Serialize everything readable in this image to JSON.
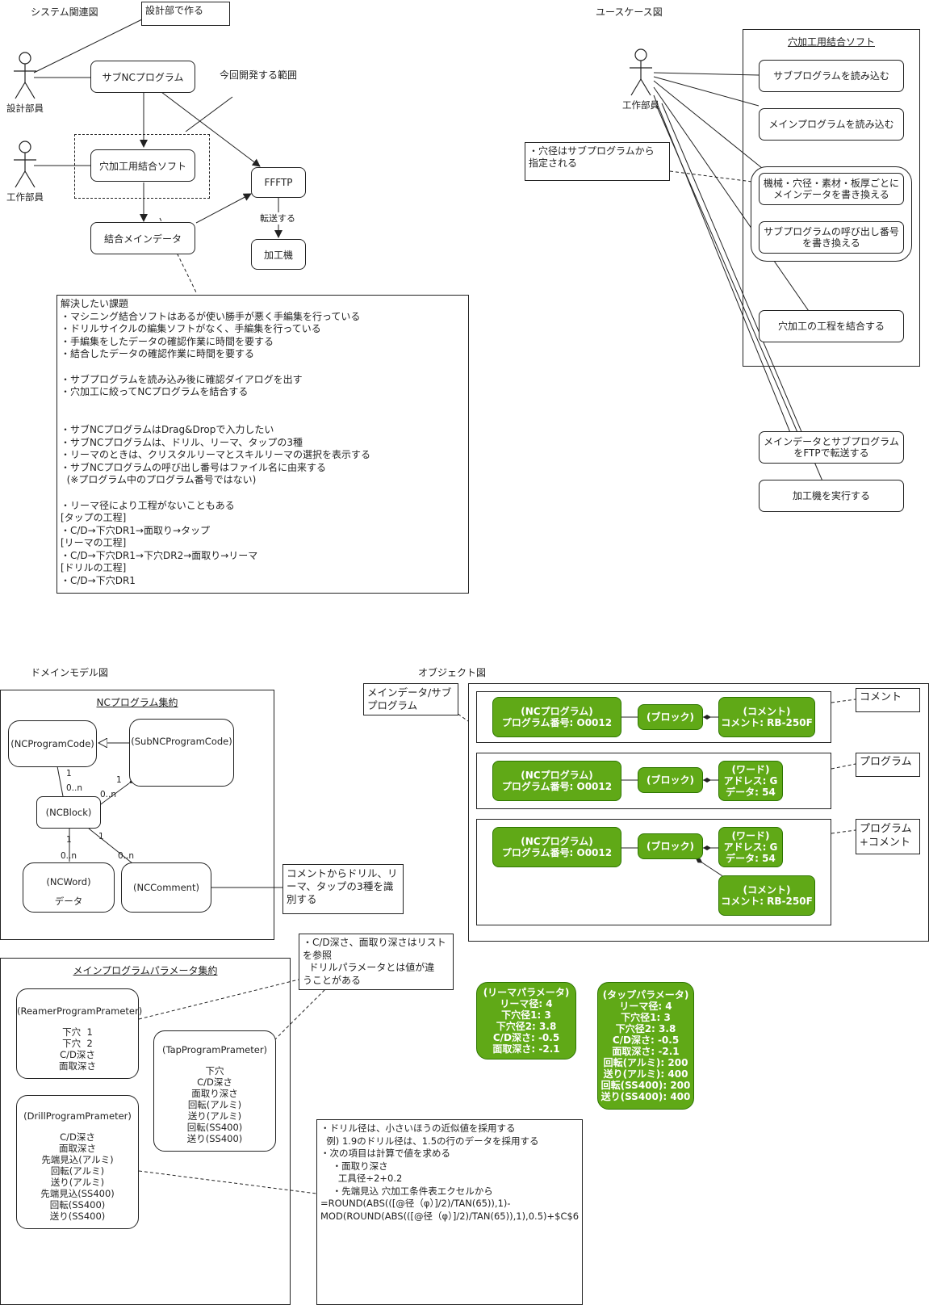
{
  "system_diagram": {
    "title": "システム関連図",
    "note_designed_by": "設計部で作る",
    "actor_design": "設計部員",
    "actor_work": "工作部員",
    "sub_nc_program": "サブNCプログラム",
    "scope_label": "今回開発する範囲",
    "hole_software": "穴加工用結合ソフト",
    "ffftp": "FFFTP",
    "transfer_label": "転送する",
    "machine": "加工機",
    "merged_main_data": "結合メインデータ",
    "issues_note": "解決したい課題\n・マシニング結合ソフトはあるが使い勝手が悪く手編集を行っている\n・ドリルサイクルの編集ソフトがなく、手編集を行っている\n・手編集をしたデータの確認作業に時間を要する\n・結合したデータの確認作業に時間を要する\n\n・サブプログラムを読み込み後に確認ダイアログを出す\n・穴加工に絞ってNCプログラムを結合する\n\n\n・サブNCプログラムはDrag&Dropで入力したい\n・サブNCプログラムは、ドリル、リーマ、タップの3種\n・リーマのときは、クリスタルリーマとスキルリーマの選択を表示する\n・サブNCプログラムの呼び出し番号はファイル名に由来する\n  (※プログラム中のプログラム番号ではない)\n\n・リーマ径により工程がないこともある\n[タップの工程]\n・C/D→下穴DR1→面取り→タップ\n[リーマの工程]\n・C/D→下穴DR1→下穴DR2→面取り→リーマ\n[ドリルの工程]\n・C/D→下穴DR1"
  },
  "usecase_diagram": {
    "title": "ユースケース図",
    "system_title": "穴加工用結合ソフト",
    "actor": "工作部員",
    "uc_read_sub": "サブプログラムを読み込む",
    "uc_read_main": "メインプログラムを読み込む",
    "uc_rewrite_main": "機械・穴径・素材・板厚ごとに\nメインデータを書き換える",
    "uc_rewrite_call": "サブプログラムの呼び出し番号\nを書き換える",
    "uc_merge": "穴加工の工程を結合する",
    "uc_ftp": "メインデータとサブプログラム\nをFTPで転送する",
    "uc_execute": "加工機を実行する",
    "note_hole": "・穴径はサブプログラムから\n指定される"
  },
  "domain_model": {
    "title": "ドメインモデル図",
    "aggregate_title": "NCプログラム集約",
    "nc_program_code": "(NCProgramCode)",
    "sub_nc_program_code": "(SubNCProgramCode)",
    "nc_block": "(NCBlock)",
    "nc_word": "(NCWord)",
    "nc_word_attr": "データ",
    "nc_comment": "(NCComment)",
    "comment_note": "コメントからドリル、リ\nーマ、タップの3種を識\n別する",
    "mult": {
      "m1": "1",
      "m2": "0..n",
      "m3": "1",
      "m4": "0..n",
      "m5": "1",
      "m6": "0..n",
      "m7": "1",
      "m8": "0..n"
    }
  },
  "param_aggregate": {
    "title": "メインプログラムパラメータ集約",
    "reamer_name": "(ReamerProgramPrameter)",
    "reamer_attrs": "下穴  1\n下穴  2\nC/D深さ\n面取深さ",
    "tap_name": "(TapProgramPrameter)",
    "tap_attrs": "下穴\nC/D深さ\n面取り深さ\n回転(アルミ)\n送り(アルミ)\n回転(SS400)\n送り(SS400)",
    "drill_name": "(DrillProgramPrameter)",
    "drill_attrs": "C/D深さ\n面取深さ\n先端見込(アルミ)\n回転(アルミ)\n送り(アルミ)\n先端見込(SS400)\n回転(SS400)\n送り(SS400)",
    "depth_note": "・C/D深さ、面取り深さはリスト\nを参照\n  ドリルパラメータとは値が違\nうことがある",
    "drill_note": "・ドリル径は、小さいほうの近似値を採用する\n  例) 1.9のドリル径は、1.5の行のデータを採用する\n・次の項目は計算で値を求める\n    ・面取り深さ\n      工具径÷2+0.2\n    ・先端見込 穴加工条件表エクセルから\n=ROUND(ABS(([@径（φ）]/2)/TAN(65)),1)-\nMOD(ROUND(ABS(([@径（φ）]/2)/TAN(65)),1),0.5)+$C$6"
  },
  "reamer_params": {
    "title": "(リーマパラメータ)",
    "lines": [
      "リーマ径: 4",
      "下穴径1: 3",
      "下穴径2: 3.8",
      "C/D深さ: -0.5",
      "面取深さ: -2.1"
    ]
  },
  "tap_params": {
    "title": "(タップパラメータ)",
    "lines": [
      "リーマ径: 4",
      "下穴径1: 3",
      "下穴径2: 3.8",
      "C/D深さ: -0.5",
      "面取深さ: -2.1",
      "回転(アルミ): 200",
      "送り(アルミ): 400",
      "回転(SS400): 200",
      "送り(SS400): 400"
    ]
  },
  "object_diagram": {
    "title": "オブジェクト図",
    "main_sub_note": "メインデータ/サブ\nプログラム",
    "row1": {
      "program": "(NCプログラム)\nプログラム番号: O0012",
      "block": "(ブロック)",
      "comment": "(コメント)\nコメント: RB-250F",
      "label": "コメント"
    },
    "row2": {
      "program": "(NCプログラム)\nプログラム番号: O0012",
      "block": "(ブロック)",
      "word": "(ワード)\nアドレス: G\nデータ: 54",
      "label": "プログラム"
    },
    "row3": {
      "program": "(NCプログラム)\nプログラム番号: O0012",
      "block": "(ブロック)",
      "word": "(ワード)\nアドレス: G\nデータ: 54",
      "comment": "(コメント)\nコメント: RB-250F",
      "label": "プログラム\n+コメント"
    }
  },
  "colors": {
    "object_fill": "#60a917",
    "object_stroke": "#2d7600",
    "line": "#222222"
  }
}
